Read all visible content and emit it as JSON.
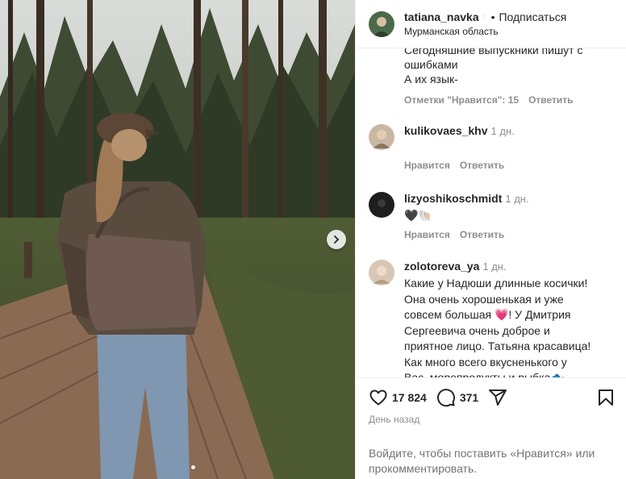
{
  "post": {
    "author": "tatiana_navka",
    "follow_label": "Подписаться",
    "separator": "•",
    "location": "Мурманская область"
  },
  "comments": [
    {
      "text_lines": [
        "Сегодняшние выпускники пишут с",
        "ошибками",
        "А их язык-"
      ],
      "likes_label": "Отметки \"Нравится\": 15",
      "reply_label": "Ответить"
    },
    {
      "username": "kulikovaes_khv",
      "time": "1 дн.",
      "text": "",
      "like_label": "Нравится",
      "reply_label": "Ответить"
    },
    {
      "username": "lizyoshikoschmidt",
      "time": "1 дн.",
      "text": "🖤🐚",
      "like_label": "Нравится",
      "reply_label": "Ответить"
    },
    {
      "username": "zolotoreva_ya",
      "time": "1 дн.",
      "text_lines": [
        "Какие у Надюши длинные косички!",
        "Она очень хорошенькая и уже",
        "совсем большая 💗! У Дмитрия",
        "Сергеевича очень доброе и",
        "приятное лицо. Татьяна красавица!",
        "Как много всего вкусненького у",
        "Вас, морепродукты и рыбка🐟"
      ]
    }
  ],
  "actions": {
    "likes_count": "17 824",
    "comments_count": "371"
  },
  "time_ago": "День назад",
  "login_hint": "Войдите, чтобы поставить «Нравится» или прокомментировать.",
  "icons": [
    "heart-icon",
    "comment-icon",
    "share-icon",
    "bookmark-icon",
    "chevron-right-icon",
    "verified-icon"
  ]
}
